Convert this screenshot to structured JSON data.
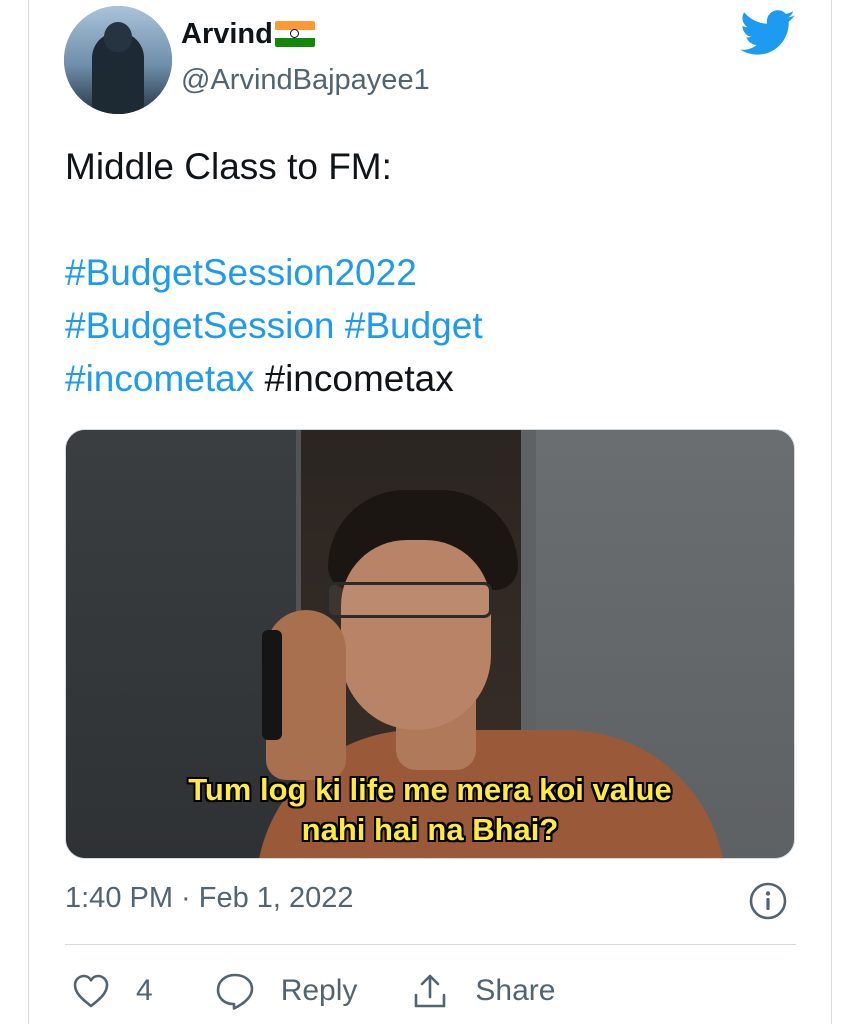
{
  "tweet": {
    "author_name": "Arvind",
    "author_flag": "India flag",
    "author_handle": "@ArvindBajpayee1",
    "text_line1": "Middle Class to FM:",
    "hashtags": {
      "line1_a": "#BudgetSession2022",
      "line2_a": "#BudgetSession",
      "line2_b": "#Budget",
      "line3_a": "#incometax",
      "line3_b": "#incometax"
    },
    "media_caption_line1": "Tum log ki life me mera koi value",
    "media_caption_line2": "nahi hai na Bhai?",
    "timestamp": "1:40 PM · Feb 1, 2022"
  },
  "actions": {
    "like_count": "4",
    "reply_label": "Reply",
    "share_label": "Share"
  },
  "icons": {
    "brand": "twitter-bird-icon",
    "info": "info-icon",
    "like": "heart-icon",
    "reply": "speech-bubble-icon",
    "share": "share-icon"
  },
  "colors": {
    "brand_blue": "#1d9bf0",
    "text": "#0f1419",
    "muted": "#536471",
    "caption_yellow": "#ffea3d"
  }
}
